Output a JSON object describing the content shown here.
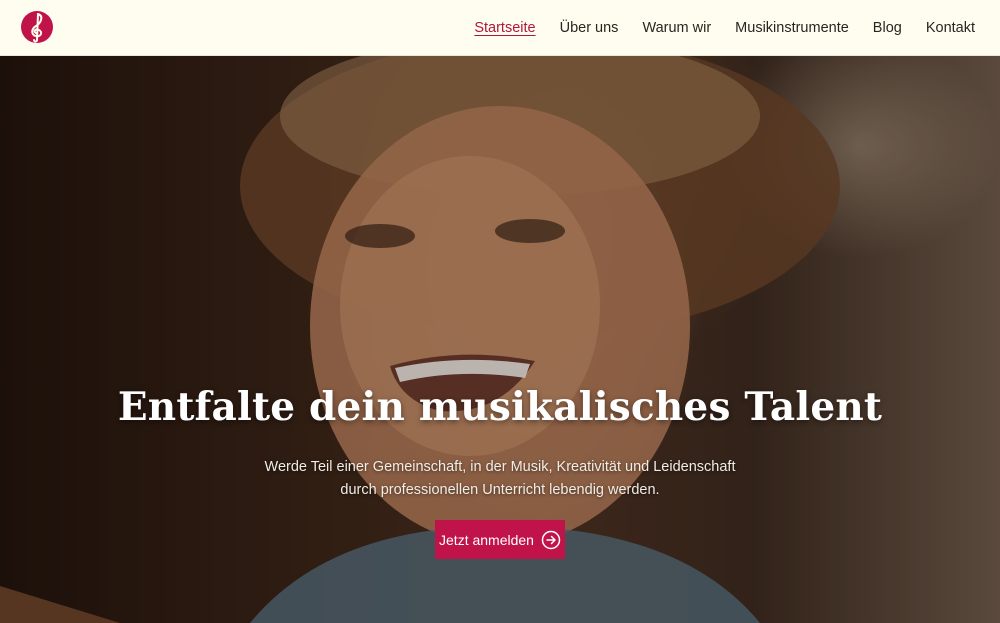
{
  "brand": {
    "logo_icon": "treble-clef-icon",
    "accent_color": "#c0134a"
  },
  "nav": {
    "items": [
      {
        "label": "Startseite",
        "active": true
      },
      {
        "label": "Über uns"
      },
      {
        "label": "Warum wir"
      },
      {
        "label": "Musikinstrumente"
      },
      {
        "label": "Blog"
      },
      {
        "label": "Kontakt"
      }
    ]
  },
  "hero": {
    "title": "Entfalte dein musikalisches Talent",
    "subtitle_line1": "Werde Teil einer Gemeinschaft, in der Musik, Kreativität und Leidenschaft",
    "subtitle_line2": "durch professionellen Unterricht lebendig werden.",
    "cta_label": "Jetzt anmelden",
    "cta_icon": "arrow-right-circle-icon"
  }
}
